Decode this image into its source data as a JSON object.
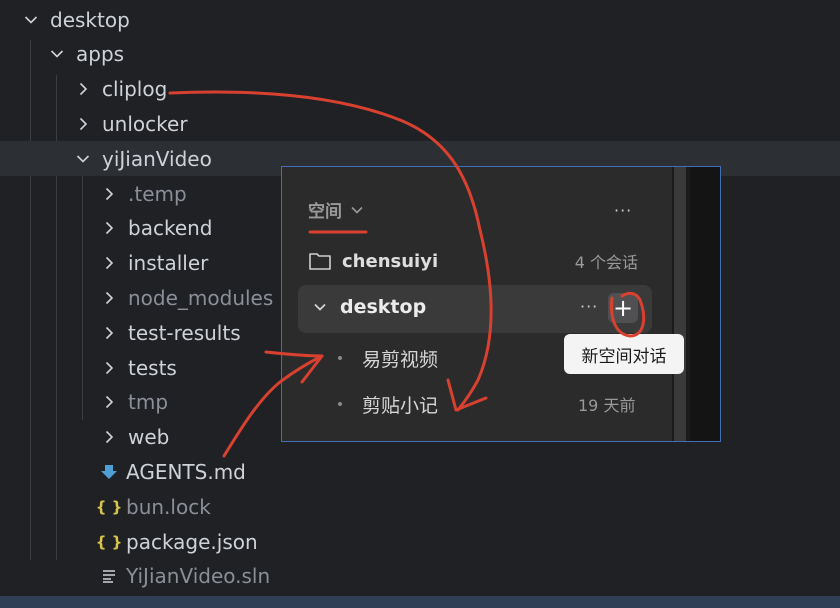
{
  "explorer": {
    "items": [
      {
        "label": "desktop",
        "type": "folder-open",
        "depth": 0,
        "dim": false
      },
      {
        "label": "apps",
        "type": "folder-open",
        "depth": 1,
        "dim": false
      },
      {
        "label": "cliplog",
        "type": "folder",
        "depth": 2,
        "dim": false
      },
      {
        "label": "unlocker",
        "type": "folder",
        "depth": 2,
        "dim": false
      },
      {
        "label": "yiJianVideo",
        "type": "folder-open",
        "depth": 2,
        "dim": false,
        "selected": true
      },
      {
        "label": ".temp",
        "type": "folder",
        "depth": 3,
        "dim": true
      },
      {
        "label": "backend",
        "type": "folder",
        "depth": 3,
        "dim": false
      },
      {
        "label": "installer",
        "type": "folder",
        "depth": 3,
        "dim": false
      },
      {
        "label": "node_modules",
        "type": "folder",
        "depth": 3,
        "dim": true
      },
      {
        "label": "test-results",
        "type": "folder",
        "depth": 3,
        "dim": false
      },
      {
        "label": "tests",
        "type": "folder",
        "depth": 3,
        "dim": false
      },
      {
        "label": "tmp",
        "type": "folder",
        "depth": 3,
        "dim": true
      },
      {
        "label": "web",
        "type": "folder",
        "depth": 3,
        "dim": false
      },
      {
        "label": "AGENTS.md",
        "type": "markdown",
        "depth": 3,
        "dim": false
      },
      {
        "label": "bun.lock",
        "type": "json",
        "depth": 3,
        "dim": true
      },
      {
        "label": "package.json",
        "type": "json",
        "depth": 3,
        "dim": false
      },
      {
        "label": "YiJianVideo.sln",
        "type": "sln",
        "depth": 3,
        "dim": true
      }
    ]
  },
  "popup": {
    "header": "空间",
    "workspaces": [
      {
        "name": "chensuiyi",
        "count": "4 个会话"
      }
    ],
    "active_workspace": {
      "name": "desktop"
    },
    "conversations": [
      {
        "title": "易剪视频",
        "time": ""
      },
      {
        "title": "剪贴小记",
        "time": "19 天前"
      }
    ],
    "more_glyph": "···",
    "plus_glyph": "+",
    "tooltip": "新空间对话"
  },
  "colors": {
    "annotation": "#d8412f",
    "popup_border": "#3f6fb8",
    "tree_text": "#cfd3d8",
    "dim_text": "#8a8f98",
    "markdown_icon": "#4e9fd6",
    "json_icon": "#d8c64a"
  }
}
